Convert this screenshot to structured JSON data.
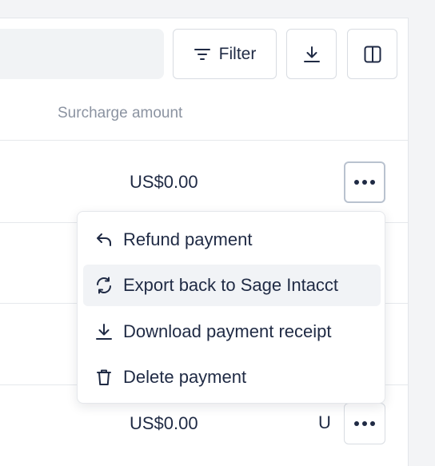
{
  "toolbar": {
    "filter_label": "Filter",
    "filter_icon": "filter-lines-icon",
    "download_icon": "download-icon",
    "columns_icon": "columns-icon"
  },
  "table": {
    "columns": [
      "Surcharge amount"
    ],
    "rows": [
      {
        "surcharge_amount": "US$0.00"
      },
      {
        "surcharge_amount": ""
      },
      {
        "surcharge_amount": ""
      },
      {
        "surcharge_amount": "US$0.00",
        "next_cell_partial": "U"
      }
    ]
  },
  "row_menu": {
    "items": [
      {
        "label": "Refund payment",
        "icon": "undo-arrow-icon"
      },
      {
        "label": "Export back to Sage Intacct",
        "icon": "sync-icon"
      },
      {
        "label": "Download payment receipt",
        "icon": "download-icon"
      },
      {
        "label": "Delete payment",
        "icon": "trash-icon"
      }
    ]
  },
  "colors": {
    "text": "#1f2a44",
    "muted": "#8b93a1",
    "border": "#d8dce2",
    "hover": "#f1f3f6"
  }
}
